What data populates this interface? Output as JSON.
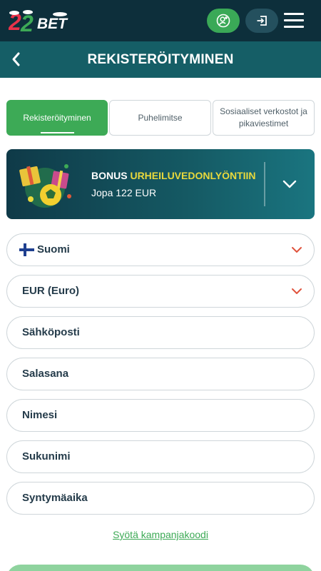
{
  "header": {
    "logo_text": "22BET",
    "profile_button": "user-add-icon",
    "login_button": "login-icon",
    "menu_button": "hamburger-menu-icon"
  },
  "titlebar": {
    "title": "REKISTERÖITYMINEN",
    "back_icon": "chevron-left-icon"
  },
  "tabs": [
    {
      "label": "Rekisteröityminen",
      "active": true
    },
    {
      "label": "Puhelimitse",
      "active": false
    },
    {
      "label": "Sosiaaliset verkostot ja pikaviestimet",
      "active": false
    }
  ],
  "bonus": {
    "title_prefix": "BONUS",
    "title_highlight": "URHEILUVEDONLYÖNTIIN",
    "subtitle": "Jopa 122 EUR",
    "expand_icon": "chevron-down-icon"
  },
  "form": {
    "country": "Suomi",
    "currency": "EUR (Euro)",
    "email_placeholder": "Sähköposti",
    "password_placeholder": "Salasana",
    "first_name_placeholder": "Nimesi",
    "last_name_placeholder": "Sukunimi",
    "birthdate_placeholder": "Syntymäaika"
  },
  "promo_link": "Syötä kampanjakoodi",
  "colors": {
    "header_bg": "#0d2f3b",
    "titlebar_bg": "#155e66",
    "accent_green": "#3daa56",
    "highlight_yellow": "#e9d93c",
    "dropdown_chevron": "#e0533d"
  }
}
